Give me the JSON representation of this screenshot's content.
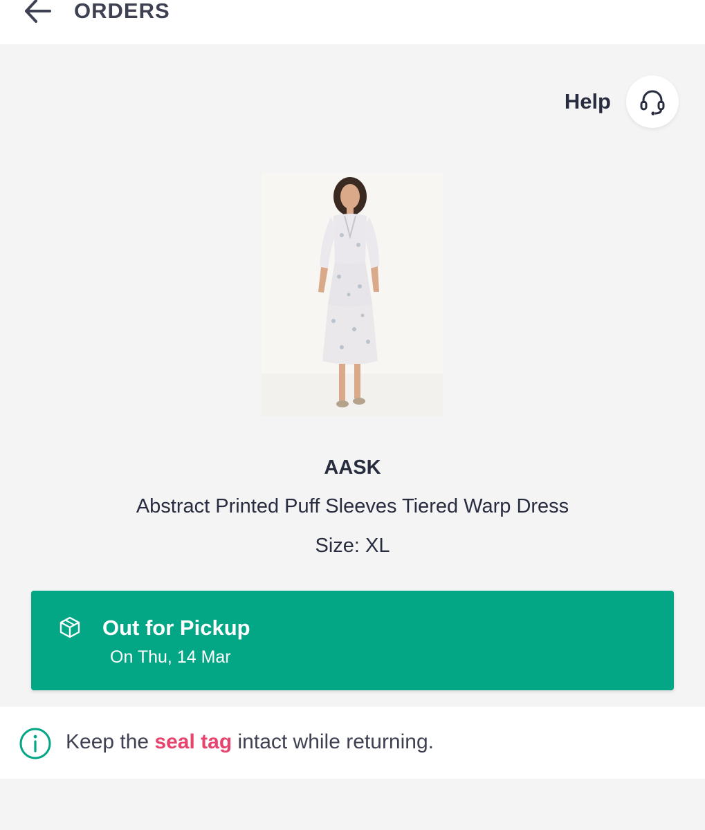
{
  "header": {
    "title": "ORDERS",
    "back_icon": "arrow-left-icon"
  },
  "help": {
    "label": "Help",
    "icon": "headset-icon"
  },
  "product": {
    "brand": "AASK",
    "name": "Abstract Printed Puff Sleeves Tiered Warp Dress",
    "size": "Size: XL"
  },
  "status": {
    "title": "Out for Pickup",
    "date": "On Thu, 14 Mar",
    "icon": "package-icon",
    "color": "#03a685"
  },
  "info": {
    "icon": "info-circle-icon",
    "prefix": "Keep the ",
    "highlight": "seal tag",
    "suffix": " intact while returning.",
    "highlight_color": "#e6436d",
    "icon_color": "#03a685"
  }
}
